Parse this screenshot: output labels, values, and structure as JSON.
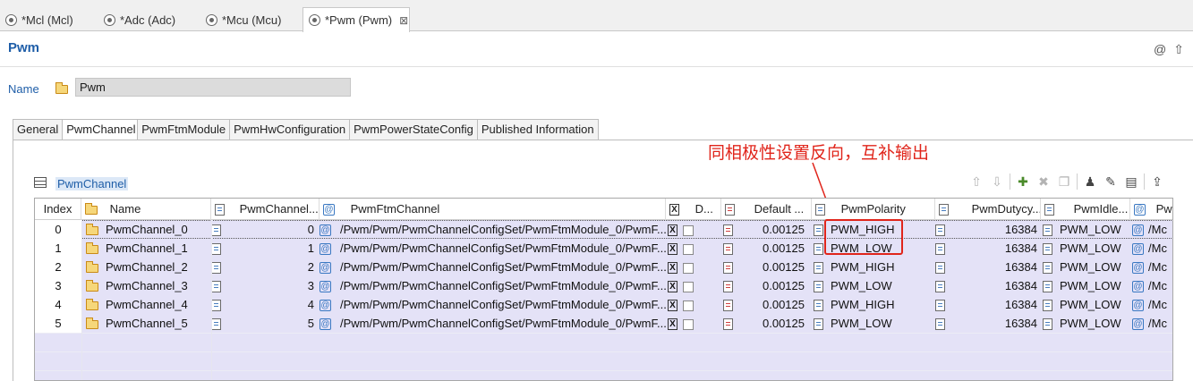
{
  "editor_tabs": [
    {
      "label": "*Mcl (Mcl)",
      "active": false
    },
    {
      "label": "*Adc (Adc)",
      "active": false
    },
    {
      "label": "*Mcu (Mcu)",
      "active": false
    },
    {
      "label": "*Pwm (Pwm)",
      "active": true,
      "close": "⊠"
    }
  ],
  "header": {
    "title": "Pwm",
    "icons": [
      "at-icon",
      "arrow-up-icon"
    ]
  },
  "name_field": {
    "label": "Name",
    "value": "Pwm"
  },
  "config_tabs": [
    "General",
    "PwmChannel",
    "PwmFtmModule",
    "PwmHwConfiguration",
    "PwmPowerStateConfig",
    "Published Information"
  ],
  "annotation": {
    "text": "同相极性设置反向，互补输出",
    "color": "#e0251b"
  },
  "section": {
    "title": "PwmChannel"
  },
  "table": {
    "columns": [
      "Index",
      "Name",
      "PwmChannel...",
      "PwmFtmChannel",
      "D...",
      "Default ...",
      "PwmPolarity",
      "PwmDutycy...",
      "PwmIdle...",
      "Pw"
    ],
    "rows": [
      {
        "index": "0",
        "name": "PwmChannel_0",
        "channel": "0",
        "ftm": "/Pwm/Pwm/PwmChannelConfigSet/PwmFtmModule_0/PwmF...",
        "default": "0.00125",
        "polarity": "PWM_HIGH",
        "duty": "16384",
        "idle": "PWM_LOW",
        "last": "/Mc"
      },
      {
        "index": "1",
        "name": "PwmChannel_1",
        "channel": "1",
        "ftm": "/Pwm/Pwm/PwmChannelConfigSet/PwmFtmModule_0/PwmF...",
        "default": "0.00125",
        "polarity": "PWM_LOW",
        "duty": "16384",
        "idle": "PWM_LOW",
        "last": "/Mc"
      },
      {
        "index": "2",
        "name": "PwmChannel_2",
        "channel": "2",
        "ftm": "/Pwm/Pwm/PwmChannelConfigSet/PwmFtmModule_0/PwmF...",
        "default": "0.00125",
        "polarity": "PWM_HIGH",
        "duty": "16384",
        "idle": "PWM_LOW",
        "last": "/Mc"
      },
      {
        "index": "3",
        "name": "PwmChannel_3",
        "channel": "3",
        "ftm": "/Pwm/Pwm/PwmChannelConfigSet/PwmFtmModule_0/PwmF...",
        "default": "0.00125",
        "polarity": "PWM_LOW",
        "duty": "16384",
        "idle": "PWM_LOW",
        "last": "/Mc"
      },
      {
        "index": "4",
        "name": "PwmChannel_4",
        "channel": "4",
        "ftm": "/Pwm/Pwm/PwmChannelConfigSet/PwmFtmModule_0/PwmF...",
        "default": "0.00125",
        "polarity": "PWM_HIGH",
        "duty": "16384",
        "idle": "PWM_LOW",
        "last": "/Mc"
      },
      {
        "index": "5",
        "name": "PwmChannel_5",
        "channel": "5",
        "ftm": "/Pwm/Pwm/PwmChannelConfigSet/PwmFtmModule_0/PwmF...",
        "default": "0.00125",
        "polarity": "PWM_LOW",
        "duty": "16384",
        "idle": "PWM_LOW",
        "last": "/Mc"
      }
    ]
  },
  "colors": {
    "accent": "#1f5ea8",
    "row_bg": "#e4e2f7",
    "highlight": "#e0251b"
  }
}
